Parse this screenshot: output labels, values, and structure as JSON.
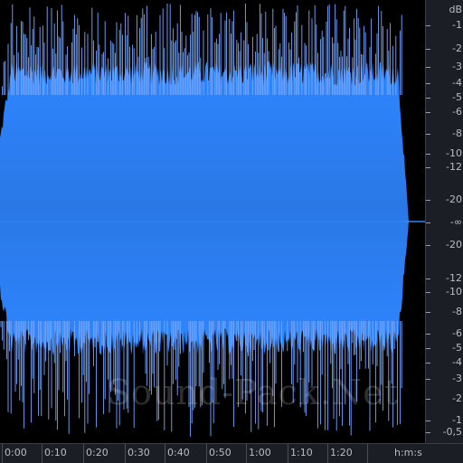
{
  "colors": {
    "background": "#000000",
    "waveform_fill": "#2f86ff",
    "waveform_fill_mid": "#2a78e6",
    "waveform_spike": "#7aa8ff",
    "ruler_background": "#1b1f25",
    "ruler_text": "#b8bcc4"
  },
  "db_scale": {
    "unit_label": "dB",
    "labels": [
      "-1",
      "-2",
      "-3",
      "-4",
      "-5",
      "-6",
      "-8",
      "-10",
      "-12",
      "-20",
      "-∞",
      "-20",
      "-12",
      "-10",
      "-8",
      "-6",
      "-5",
      "-4",
      "-3",
      "-2",
      "-1",
      "-0,5"
    ]
  },
  "time_ruler": {
    "labels": [
      "0:00",
      "0:10",
      "0:20",
      "0:30",
      "0:40",
      "0:50",
      "1:00",
      "1:10",
      "1:20"
    ],
    "unit_label": "h:m:s"
  },
  "watermark": {
    "text": "Sound-Pack.Net"
  }
}
